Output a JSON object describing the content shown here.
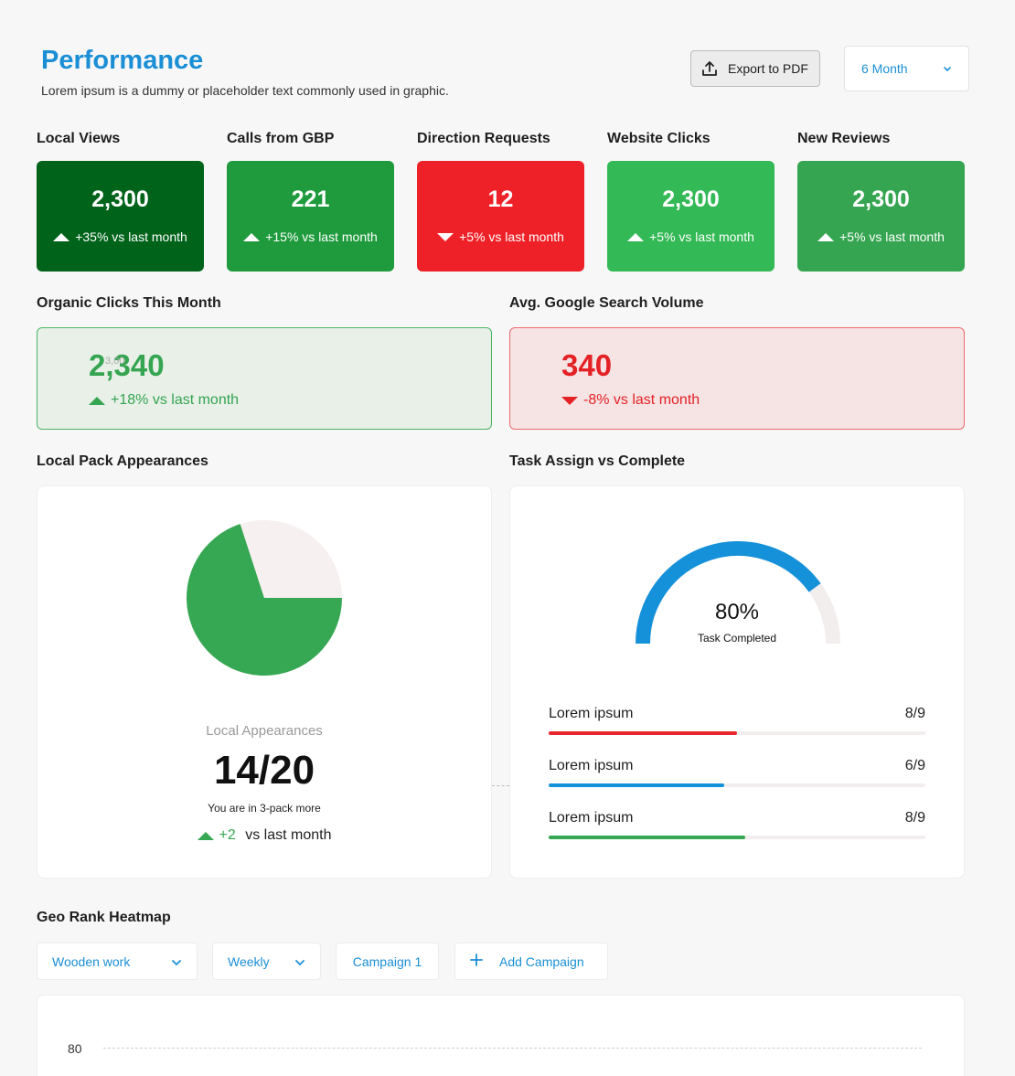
{
  "header": {
    "title": "Performance",
    "subtitle": "Lorem ipsum is a dummy or placeholder text commonly used in graphic.",
    "export_label": "Export to PDF",
    "period_value": "6 Month",
    "export_icon": "upload-icon",
    "chevron_icon": "chevron-down-icon"
  },
  "kpis": [
    {
      "label": "Local Views",
      "value": "2,300",
      "delta": "+35% vs last month",
      "direction": "up",
      "color": "#00631a"
    },
    {
      "label": "Calls from GBP",
      "value": "221",
      "delta": "+15% vs last month",
      "direction": "up",
      "color": "#1f9b3d"
    },
    {
      "label": "Direction Requests",
      "value": "12",
      "delta": "+5% vs last month",
      "direction": "down",
      "color": "#ef2128"
    },
    {
      "label": "Website Clicks",
      "value": "2,300",
      "delta": "+5% vs last month",
      "direction": "up",
      "color": "#33b955"
    },
    {
      "label": "New Reviews",
      "value": "2,300",
      "delta": "+5% vs last month",
      "direction": "up",
      "color": "#35a551"
    }
  ],
  "organic": {
    "label": "Organic Clicks This Month",
    "value": "2,340",
    "ghost": "3,00",
    "delta": "+18% vs last month",
    "color": "#35a551",
    "bg": "#e8f0e8",
    "border": "#4bb566"
  },
  "search_volume": {
    "label": "Avg. Google Search Volume",
    "value": "340",
    "delta": "-8% vs last month",
    "color": "#e42226",
    "bg": "#f6e3e4",
    "border": "#ee6a6e"
  },
  "local_pack": {
    "label": "Local Pack Appearances",
    "caption": "Local Appearances",
    "value": "14/20",
    "note": "You are in 3-pack more",
    "delta_value": "+2",
    "delta_text": " vs last month",
    "chart_data": {
      "type": "pie",
      "values": [
        14,
        6
      ],
      "colors": [
        "#36a752",
        "#f6f0f0"
      ]
    }
  },
  "task": {
    "label": "Task Assign vs Complete",
    "percent_label": "80%",
    "percent": 80,
    "caption": "Task Completed",
    "gauge_color": "#1591da",
    "rows": [
      {
        "name": "Lorem ipsum",
        "value": "8/9",
        "fill": 0.5,
        "color": "#e8262d"
      },
      {
        "name": "Lorem ipsum",
        "value": "6/9",
        "fill": 0.466,
        "color": "#1591da"
      },
      {
        "name": "Lorem ipsum",
        "value": "8/9",
        "fill": 0.522,
        "color": "#36a752"
      }
    ]
  },
  "heatmap": {
    "label": "Geo Rank Heatmap",
    "filter_1": "Wooden work",
    "filter_2": "Weekly",
    "campaign": "Campaign 1",
    "add_campaign": "Add Campaign",
    "y_tick": "80"
  }
}
